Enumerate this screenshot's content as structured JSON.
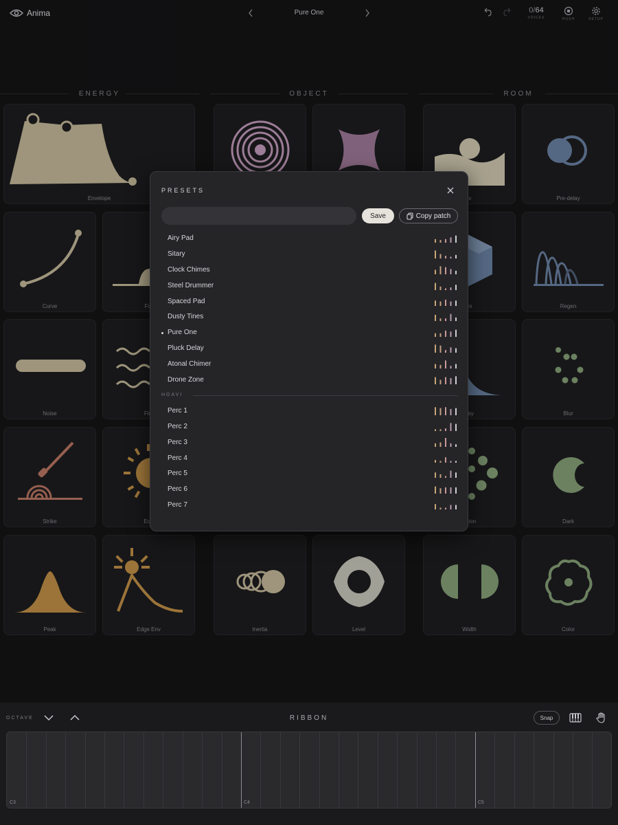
{
  "app": {
    "name": "Anima",
    "current_preset": "Pure One"
  },
  "toolbar": {
    "voices_used": "0",
    "voices_total": "64",
    "voices_label": "VOICES",
    "hush_label": "HUSH",
    "setup_label": "SETUP",
    "icons": [
      "eye-logo-icon",
      "chevron-left-icon",
      "chevron-right-icon",
      "undo-icon",
      "redo-icon",
      "hush-icon",
      "gear-icon"
    ]
  },
  "sections": {
    "energy": "ENERGY",
    "object": "OBJECT",
    "room": "ROOM"
  },
  "tiles": {
    "envelope": "Envelope",
    "mix": "ix",
    "predelay": "Pre-delay",
    "curve": "Curve",
    "form": "For",
    "size": "ze",
    "regen": "Regen",
    "noise": "Noise",
    "flutter": "Flut",
    "decay": "cay",
    "blur": "Blur",
    "strike": "Strike",
    "edge": "Edg",
    "diffusion": "usion",
    "dark": "Dark",
    "peak": "Peak",
    "edge_env": "Edge Env",
    "inertia": "Inertia",
    "level": "Level",
    "width": "Width",
    "color": "Color"
  },
  "presets_modal": {
    "title": "PRESETS",
    "search_placeholder": "",
    "save_label": "Save",
    "copy_label": "Copy patch",
    "selected": "Pure One",
    "factory": [
      {
        "name": "Airy Pad",
        "levels": [
          0.4,
          0.3,
          0.4,
          0.6,
          0.8
        ]
      },
      {
        "name": "Sitary",
        "levels": [
          0.9,
          0.5,
          0.3,
          0.2,
          0.4
        ]
      },
      {
        "name": "Clock Chimes",
        "levels": [
          0.5,
          0.9,
          0.8,
          0.6,
          0.4
        ]
      },
      {
        "name": "Steel Drummer",
        "levels": [
          0.8,
          0.4,
          0.2,
          0.3,
          0.6
        ]
      },
      {
        "name": "Spaced Pad",
        "levels": [
          0.6,
          0.5,
          0.7,
          0.5,
          0.6
        ]
      },
      {
        "name": "Dusty Tines",
        "levels": [
          0.7,
          0.3,
          0.3,
          0.8,
          0.4
        ]
      },
      {
        "name": "Pure One",
        "levels": [
          0.4,
          0.4,
          0.7,
          0.6,
          0.8
        ]
      },
      {
        "name": "Pluck Delay",
        "levels": [
          0.9,
          0.8,
          0.3,
          0.6,
          0.5
        ]
      },
      {
        "name": "Atonal Chimer",
        "levels": [
          0.5,
          0.4,
          0.9,
          0.3,
          0.5
        ]
      },
      {
        "name": "Drone Zone",
        "levels": [
          0.8,
          0.5,
          0.8,
          0.7,
          0.9
        ]
      }
    ],
    "group_name": "HOAVI",
    "group": [
      {
        "name": "Perc 1",
        "levels": [
          0.9,
          0.8,
          0.9,
          0.7,
          0.8
        ]
      },
      {
        "name": "Perc 2",
        "levels": [
          0.2,
          0.2,
          0.3,
          0.9,
          0.8
        ]
      },
      {
        "name": "Perc 3",
        "levels": [
          0.4,
          0.5,
          1.0,
          0.4,
          0.3
        ]
      },
      {
        "name": "Perc 4",
        "levels": [
          0.3,
          0.2,
          0.6,
          0.2,
          0.2
        ]
      },
      {
        "name": "Perc 5",
        "levels": [
          0.6,
          0.4,
          0.2,
          0.8,
          0.6
        ]
      },
      {
        "name": "Perc 6",
        "levels": [
          0.8,
          0.6,
          0.7,
          0.7,
          0.7
        ]
      },
      {
        "name": "Perc 7",
        "levels": [
          0.6,
          0.2,
          0.2,
          0.5,
          0.5
        ]
      }
    ],
    "bar_colors": [
      "#c9a577",
      "#c6a084",
      "#c99a9a",
      "#b89aac",
      "#cfcfd4"
    ]
  },
  "bottom": {
    "octave_label": "OCTAVE",
    "ribbon_label": "RIBBON",
    "snap_label": "Snap",
    "notes": [
      "C3",
      "C4",
      "C5"
    ]
  },
  "colors": {
    "sand": "#cbbf9f",
    "mauve": "#c9a0c2",
    "blue": "#6e86a8",
    "green": "#8aa67b",
    "amber": "#c8954a",
    "clay": "#c07a66"
  }
}
